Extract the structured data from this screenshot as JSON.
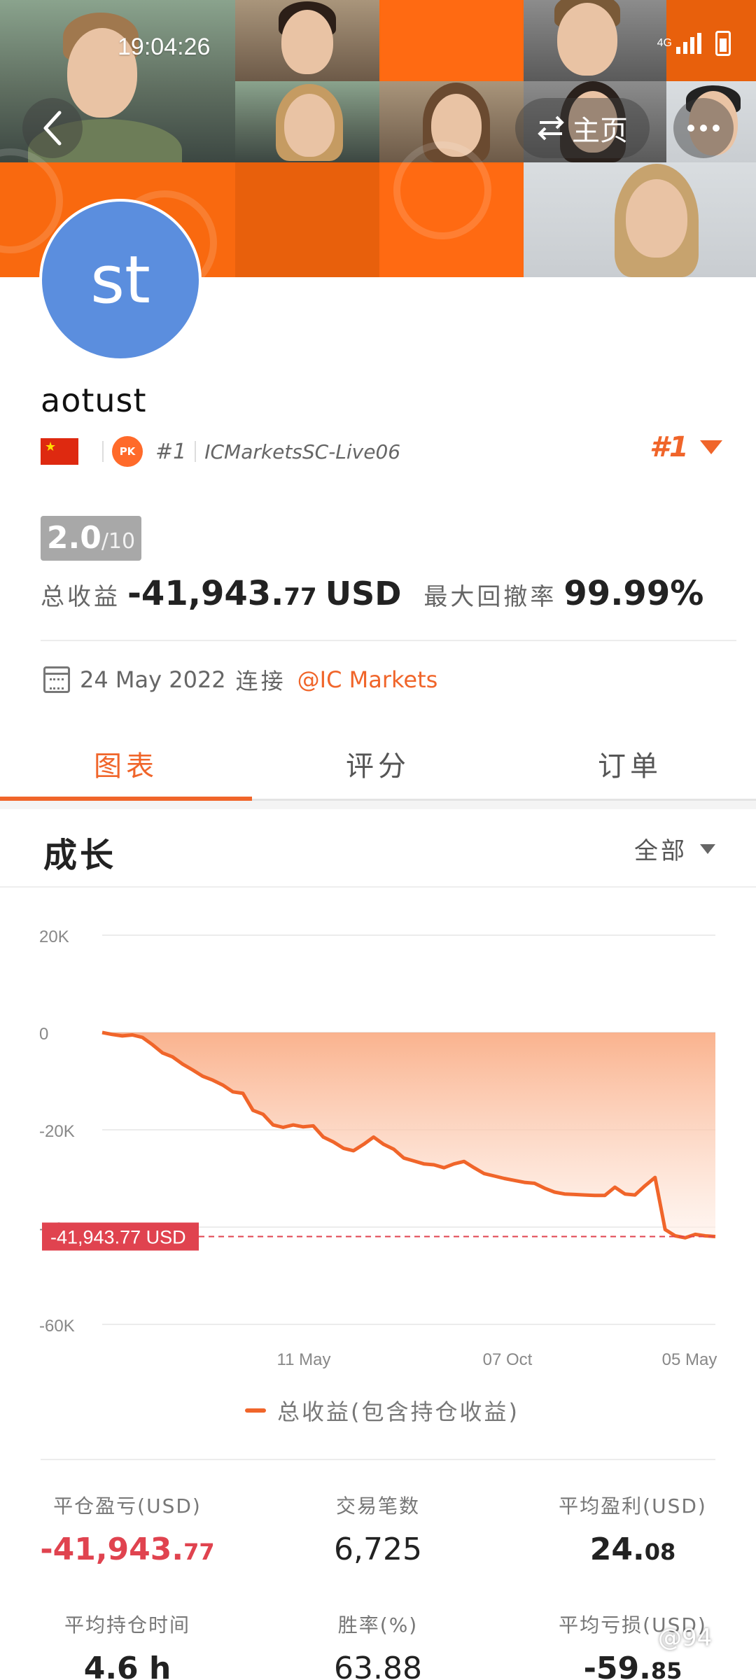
{
  "status_bar": {
    "time": "19:04:26",
    "network": "4G"
  },
  "header": {
    "home_label": "主页"
  },
  "profile": {
    "avatar_initials": "st",
    "username": "aotust",
    "pk_label": "PK",
    "rank_small": "#1",
    "server": "ICMarketsSC-Live06",
    "rank_right": "#1"
  },
  "summary": {
    "score": "2.0",
    "score_max": "/10",
    "total_pnl_label": "总收益",
    "total_pnl_value": "-41,943.",
    "total_pnl_decimal": "77",
    "total_pnl_unit": "USD",
    "drawdown_label": "最大回撤率",
    "drawdown_value": "99.99%",
    "connected_date": "24 May 2022",
    "connected_label": "连接",
    "broker_link": "@IC Markets"
  },
  "tabs": [
    {
      "label": "图表",
      "active": true
    },
    {
      "label": "评分",
      "active": false
    },
    {
      "label": "订单",
      "active": false
    }
  ],
  "growth": {
    "title": "成长",
    "range_label": "全部"
  },
  "chart_data": {
    "type": "area",
    "y_ticks": [
      "20K",
      "0",
      "-20K",
      "-40K",
      "-60K"
    ],
    "ylim": [
      -60000,
      20000
    ],
    "x_ticks": [
      "11 May",
      "07 Oct",
      "05 May"
    ],
    "current_value_label": "-41,943.77 USD",
    "current_value": -41943.77,
    "legend": "总收益(包含持仓收益)",
    "series": [
      {
        "values": [
          0,
          -400,
          -700,
          -500,
          -1000,
          -2500,
          -4200,
          -5000,
          -6500,
          -7700,
          -9000,
          -9800,
          -10800,
          -12200,
          -12500,
          -16000,
          -16800,
          -19000,
          -19500,
          -19000,
          -19400,
          -19200,
          -21500,
          -22500,
          -23800,
          -24300,
          -23000,
          -21500,
          -23000,
          -24000,
          -25800,
          -26400,
          -27000,
          -27200,
          -27800,
          -27000,
          -26500,
          -27800,
          -29000,
          -29500,
          -30000,
          -30400,
          -30800,
          -31000,
          -32000,
          -32800,
          -33200,
          -33300,
          -33400,
          -33500,
          -33500,
          -31800,
          -33200,
          -33400,
          -31500,
          -29800,
          -40500,
          -41800,
          -42200,
          -41500,
          -41800,
          -41943.77
        ]
      }
    ],
    "colors": {
      "line": "#f0652a",
      "area_top": "#f9a57a",
      "area_bottom": "#fff0e8",
      "marker": "#e0434f"
    }
  },
  "stats": [
    {
      "label": "平仓盈亏(USD)",
      "value": "-41,943.",
      "decimal": "77",
      "style": "neg"
    },
    {
      "label": "交易笔数",
      "value": "6,725",
      "decimal": "",
      "style": ""
    },
    {
      "label": "平均盈利(USD)",
      "value": "24.",
      "decimal": "08",
      "style": "bold"
    },
    {
      "label": "平均持仓时间",
      "value": "4.6 h",
      "decimal": "",
      "style": "bold"
    },
    {
      "label": "胜率(%)",
      "value": "63.88",
      "decimal": "",
      "style": ""
    },
    {
      "label": "平均亏损(USD)",
      "value": "-59.",
      "decimal": "85",
      "style": "bold"
    }
  ],
  "watermark": "@94"
}
